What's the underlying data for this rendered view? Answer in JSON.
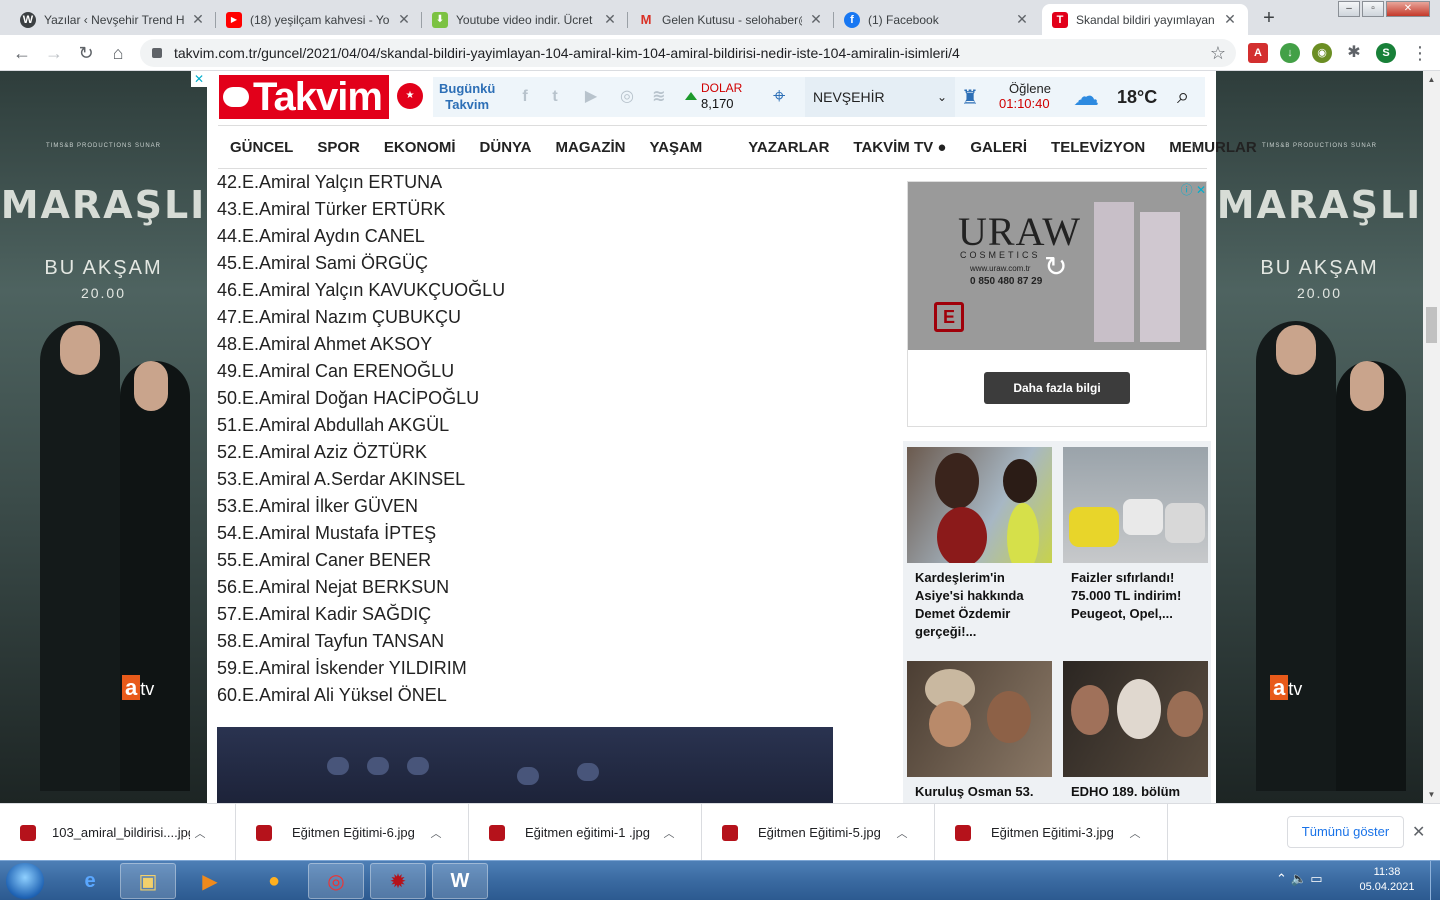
{
  "browser": {
    "tabs": [
      {
        "title": "Yazılar ‹ Nevşehir Trend Ha",
        "icon": "wordpress-icon",
        "active": false
      },
      {
        "title": "(18) yeşilçam kahvesi - You",
        "icon": "youtube-icon",
        "active": false
      },
      {
        "title": "Youtube video indir. Ücret",
        "icon": "download-site-icon",
        "active": false
      },
      {
        "title": "Gelen Kutusu - selohaber@",
        "icon": "gmail-icon",
        "active": false
      },
      {
        "title": "(1) Facebook",
        "icon": "facebook-icon",
        "active": false
      },
      {
        "title": "Skandal bildiri yayımlayan",
        "icon": "takvim-icon",
        "active": true
      }
    ],
    "url": "takvim.com.tr/guncel/2021/04/04/skandal-bildiri-yayimlayan-104-amiral-kim-104-amiral-bildirisi-nedir-iste-104-amiralin-isimleri/4",
    "profile_initial": "S"
  },
  "site": {
    "logo": "Takvim",
    "bugunku": [
      "Bugünkü",
      "Takvim"
    ],
    "dolar": {
      "label": "DOLAR",
      "value": "8,170"
    },
    "city": "NEVŞEHİR",
    "prayer": {
      "label": "Öğlene",
      "time": "01:10:40"
    },
    "temperature": "18°C",
    "nav": [
      "GÜNCEL",
      "SPOR",
      "EKONOMİ",
      "DÜNYA",
      "MAGAZİN",
      "YAŞAM",
      "YAZARLAR",
      "TAKVİM TV",
      "GALERİ",
      "TELEVİZYON",
      "MEMURLAR"
    ]
  },
  "article": {
    "items": [
      "42.E.Amiral Yalçın ERTUNA",
      "43.E.Amiral Türker ERTÜRK",
      "44.E.Amiral Aydın CANEL",
      "45.E.Amiral Sami ÖRGÜÇ",
      "46.E.Amiral Yalçın KAVUKÇUOĞLU",
      "47.E.Amiral Nazım ÇUBUKÇU",
      "48.E.Amiral Ahmet AKSOY",
      "49.E.Amiral Can ERENOĞLU",
      "50.E.Amiral Doğan HACİPOĞLU",
      "51.E.Amiral Abdullah AKGÜL",
      "52.E.Amiral Aziz ÖZTÜRK",
      "53.E.Amiral A.Serdar AKINSEL",
      "53.E.Amiral İlker GÜVEN",
      "54.E.Amiral Mustafa İPTEŞ",
      "55.E.Amiral Caner BENER",
      "56.E.Amiral Nejat BERKSUN",
      "57.E.Amiral Kadir SAĞDIÇ",
      "58.E.Amiral Tayfun TANSAN",
      "59.E.Amiral İskender YILDIRIM",
      "60.E.Amiral Ali Yüksel ÖNEL"
    ]
  },
  "ad": {
    "brand": "URAW",
    "brand_sub": "COSMETICS",
    "url": "www.uraw.com.tr",
    "phone": "0 850 480 87 29",
    "badge": "E",
    "button": "Daha fazla bilgi"
  },
  "side_ad": {
    "producer": "TIMS&B PRODUCTIONS SUNAR",
    "title": "MARAŞLI",
    "subtitle": "BU AKŞAM",
    "time": "20.00",
    "channel_a": "a",
    "channel_tv": "tv"
  },
  "cards": [
    {
      "caption": "Kardeşlerim'in Asiye'si hakkında Demet Özdemir gerçeği!..."
    },
    {
      "caption": "Faizler sıfırlandı! 75.000 TL indirim! Peugeot, Opel,..."
    },
    {
      "caption": "Kuruluş Osman 53."
    },
    {
      "caption": "EDHO 189. bölüm"
    }
  ],
  "downloads": {
    "items": [
      "103_amiral_bildirisi....jpg",
      "Eğitmen Eğitimi-6.jpg",
      "Eğitmen eğitimi-1 .jpg",
      "Eğitmen Eğitimi-5.jpg",
      "Eğitmen Eğitimi-3.jpg"
    ],
    "show_all": "Tümünü göster"
  },
  "taskbar": {
    "time": "11:38",
    "date": "05.04.2021"
  }
}
